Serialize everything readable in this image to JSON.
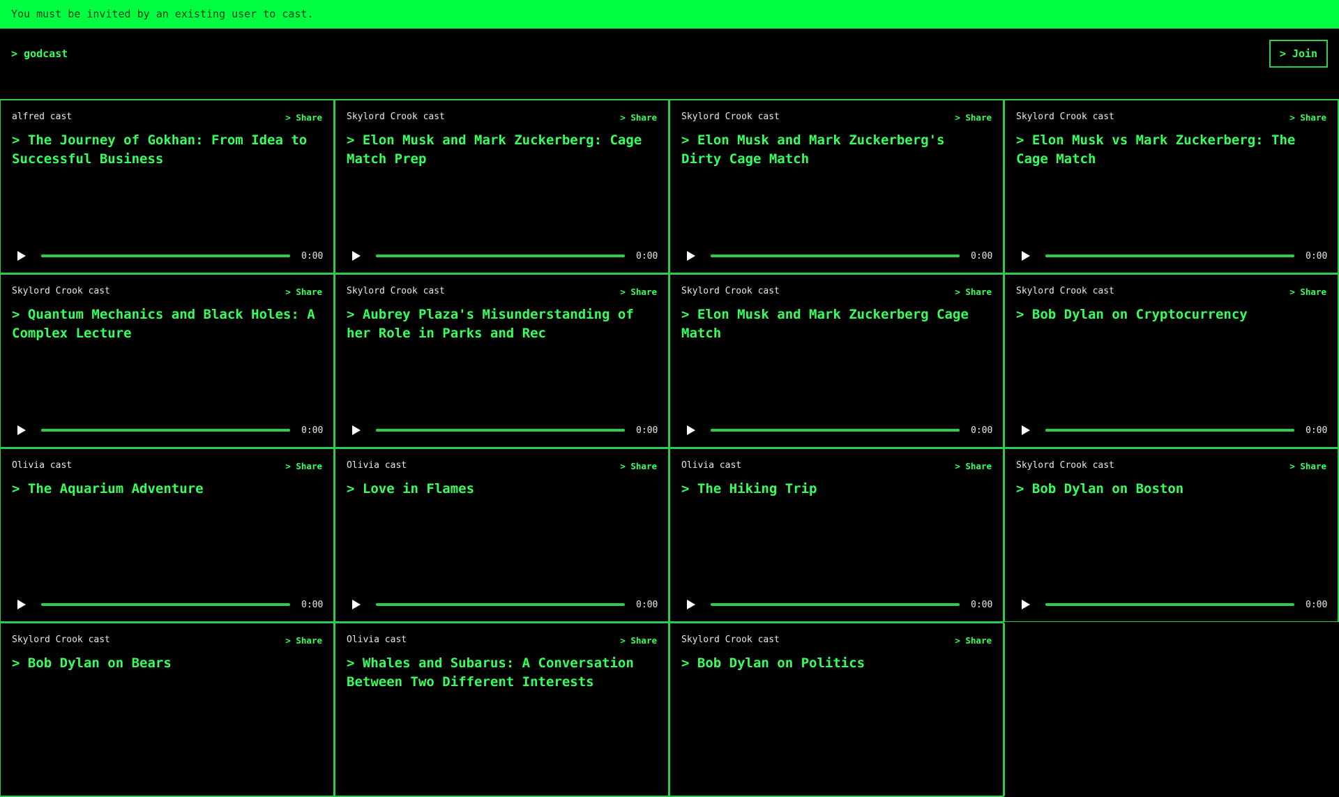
{
  "banner": {
    "text": "You must be invited by an existing user to cast."
  },
  "header": {
    "logo": "> godcast",
    "join_label": "> Join"
  },
  "share_label": "> Share",
  "colors": {
    "accent": "#00ff41",
    "text_green": "#34ff5c",
    "border": "#2ecc4b",
    "background": "#000000"
  },
  "casts": [
    {
      "author": "alfred cast",
      "title": "> The Journey of Gokhan: From Idea to Successful Business",
      "time": "0:00"
    },
    {
      "author": "Skylord Crook cast",
      "title": "> Elon Musk and Mark Zuckerberg: Cage Match Prep",
      "time": "0:00"
    },
    {
      "author": "Skylord Crook cast",
      "title": "> Elon Musk and Mark Zuckerberg's Dirty Cage Match",
      "time": "0:00"
    },
    {
      "author": "Skylord Crook cast",
      "title": "> Elon Musk vs Mark Zuckerberg: The Cage Match",
      "time": "0:00"
    },
    {
      "author": "Skylord Crook cast",
      "title": "> Quantum Mechanics and Black Holes: A Complex Lecture",
      "time": "0:00"
    },
    {
      "author": "Skylord Crook cast",
      "title": "> Aubrey Plaza's Misunderstanding of her Role in Parks and Rec",
      "time": "0:00"
    },
    {
      "author": "Skylord Crook cast",
      "title": "> Elon Musk and Mark Zuckerberg Cage Match",
      "time": "0:00"
    },
    {
      "author": "Skylord Crook cast",
      "title": "> Bob Dylan on Cryptocurrency",
      "time": "0:00"
    },
    {
      "author": "Olivia cast",
      "title": "> The Aquarium Adventure",
      "time": "0:00"
    },
    {
      "author": "Olivia cast",
      "title": "> Love in Flames",
      "time": "0:00"
    },
    {
      "author": "Olivia cast",
      "title": "> The Hiking Trip",
      "time": "0:00"
    },
    {
      "author": "Skylord Crook cast",
      "title": "> Bob Dylan on Boston",
      "time": "0:00"
    },
    {
      "author": "Skylord Crook cast",
      "title": "> Bob Dylan on Bears",
      "time": ""
    },
    {
      "author": "Olivia cast",
      "title": "> Whales and Subarus: A Conversation Between Two Different Interests",
      "time": ""
    },
    {
      "author": "Skylord Crook cast",
      "title": "> Bob Dylan on Politics",
      "time": ""
    }
  ]
}
